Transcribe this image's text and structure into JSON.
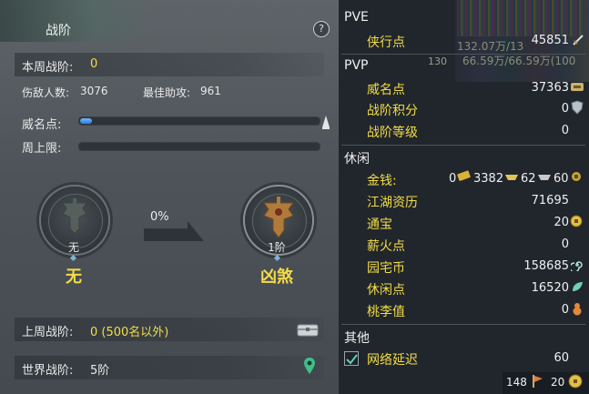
{
  "left": {
    "title": "战阶",
    "help": "?",
    "week_rank_label": "本周战阶:",
    "week_rank_value": "0",
    "kills_label": "伤敌人数:",
    "kills_value": "3076",
    "assists_label": "最佳助攻:",
    "assists_value": "961",
    "prestige_label": "威名点:",
    "prestige_progress": 0.05,
    "week_cap_label": "周上限:",
    "week_cap_progress": 0,
    "percent": "0%",
    "current_rank_level": "无",
    "current_rank_name": "无",
    "next_rank_level": "1阶",
    "next_rank_name": "凶煞",
    "last_week_label": "上周战阶:",
    "last_week_value": "0 (500名以外)",
    "world_rank_label": "世界战阶:",
    "world_rank_value": "5阶"
  },
  "right": {
    "pve": {
      "header": "PVE",
      "items": [
        {
          "name": "侠行点",
          "value": "45851",
          "icon": "sword-icon"
        }
      ]
    },
    "pvp": {
      "header": "PVP",
      "items": [
        {
          "name": "威名点",
          "value": "37363",
          "icon": "banner-icon"
        },
        {
          "name": "战阶积分",
          "value": "0",
          "icon": "shield-icon"
        },
        {
          "name": "战阶等级",
          "value": "0",
          "icon": ""
        }
      ]
    },
    "leisure": {
      "header": "休闲",
      "money_name": "金钱:",
      "money_parts": [
        "0",
        "3382",
        "62",
        "60"
      ],
      "items": [
        {
          "name": "江湖资历",
          "value": "71695",
          "icon": ""
        },
        {
          "name": "通宝",
          "value": "20",
          "icon": "coin-icon"
        },
        {
          "name": "薪火点",
          "value": "0",
          "icon": ""
        },
        {
          "name": "园宅币",
          "value": "158685",
          "icon": "spiral-icon"
        },
        {
          "name": "休闲点",
          "value": "16520",
          "icon": "leaf-icon"
        },
        {
          "name": "桃李值",
          "value": "0",
          "icon": "gourd-icon"
        }
      ]
    },
    "other": {
      "header": "其他",
      "items": [
        {
          "name": "网络延迟",
          "value": "60",
          "checked": true
        }
      ]
    },
    "bottom": {
      "count_a": "148",
      "count_b": "20"
    },
    "game_overlay": [
      "132.07万/13",
      "66.59万/66.59万(100",
      "130"
    ]
  }
}
